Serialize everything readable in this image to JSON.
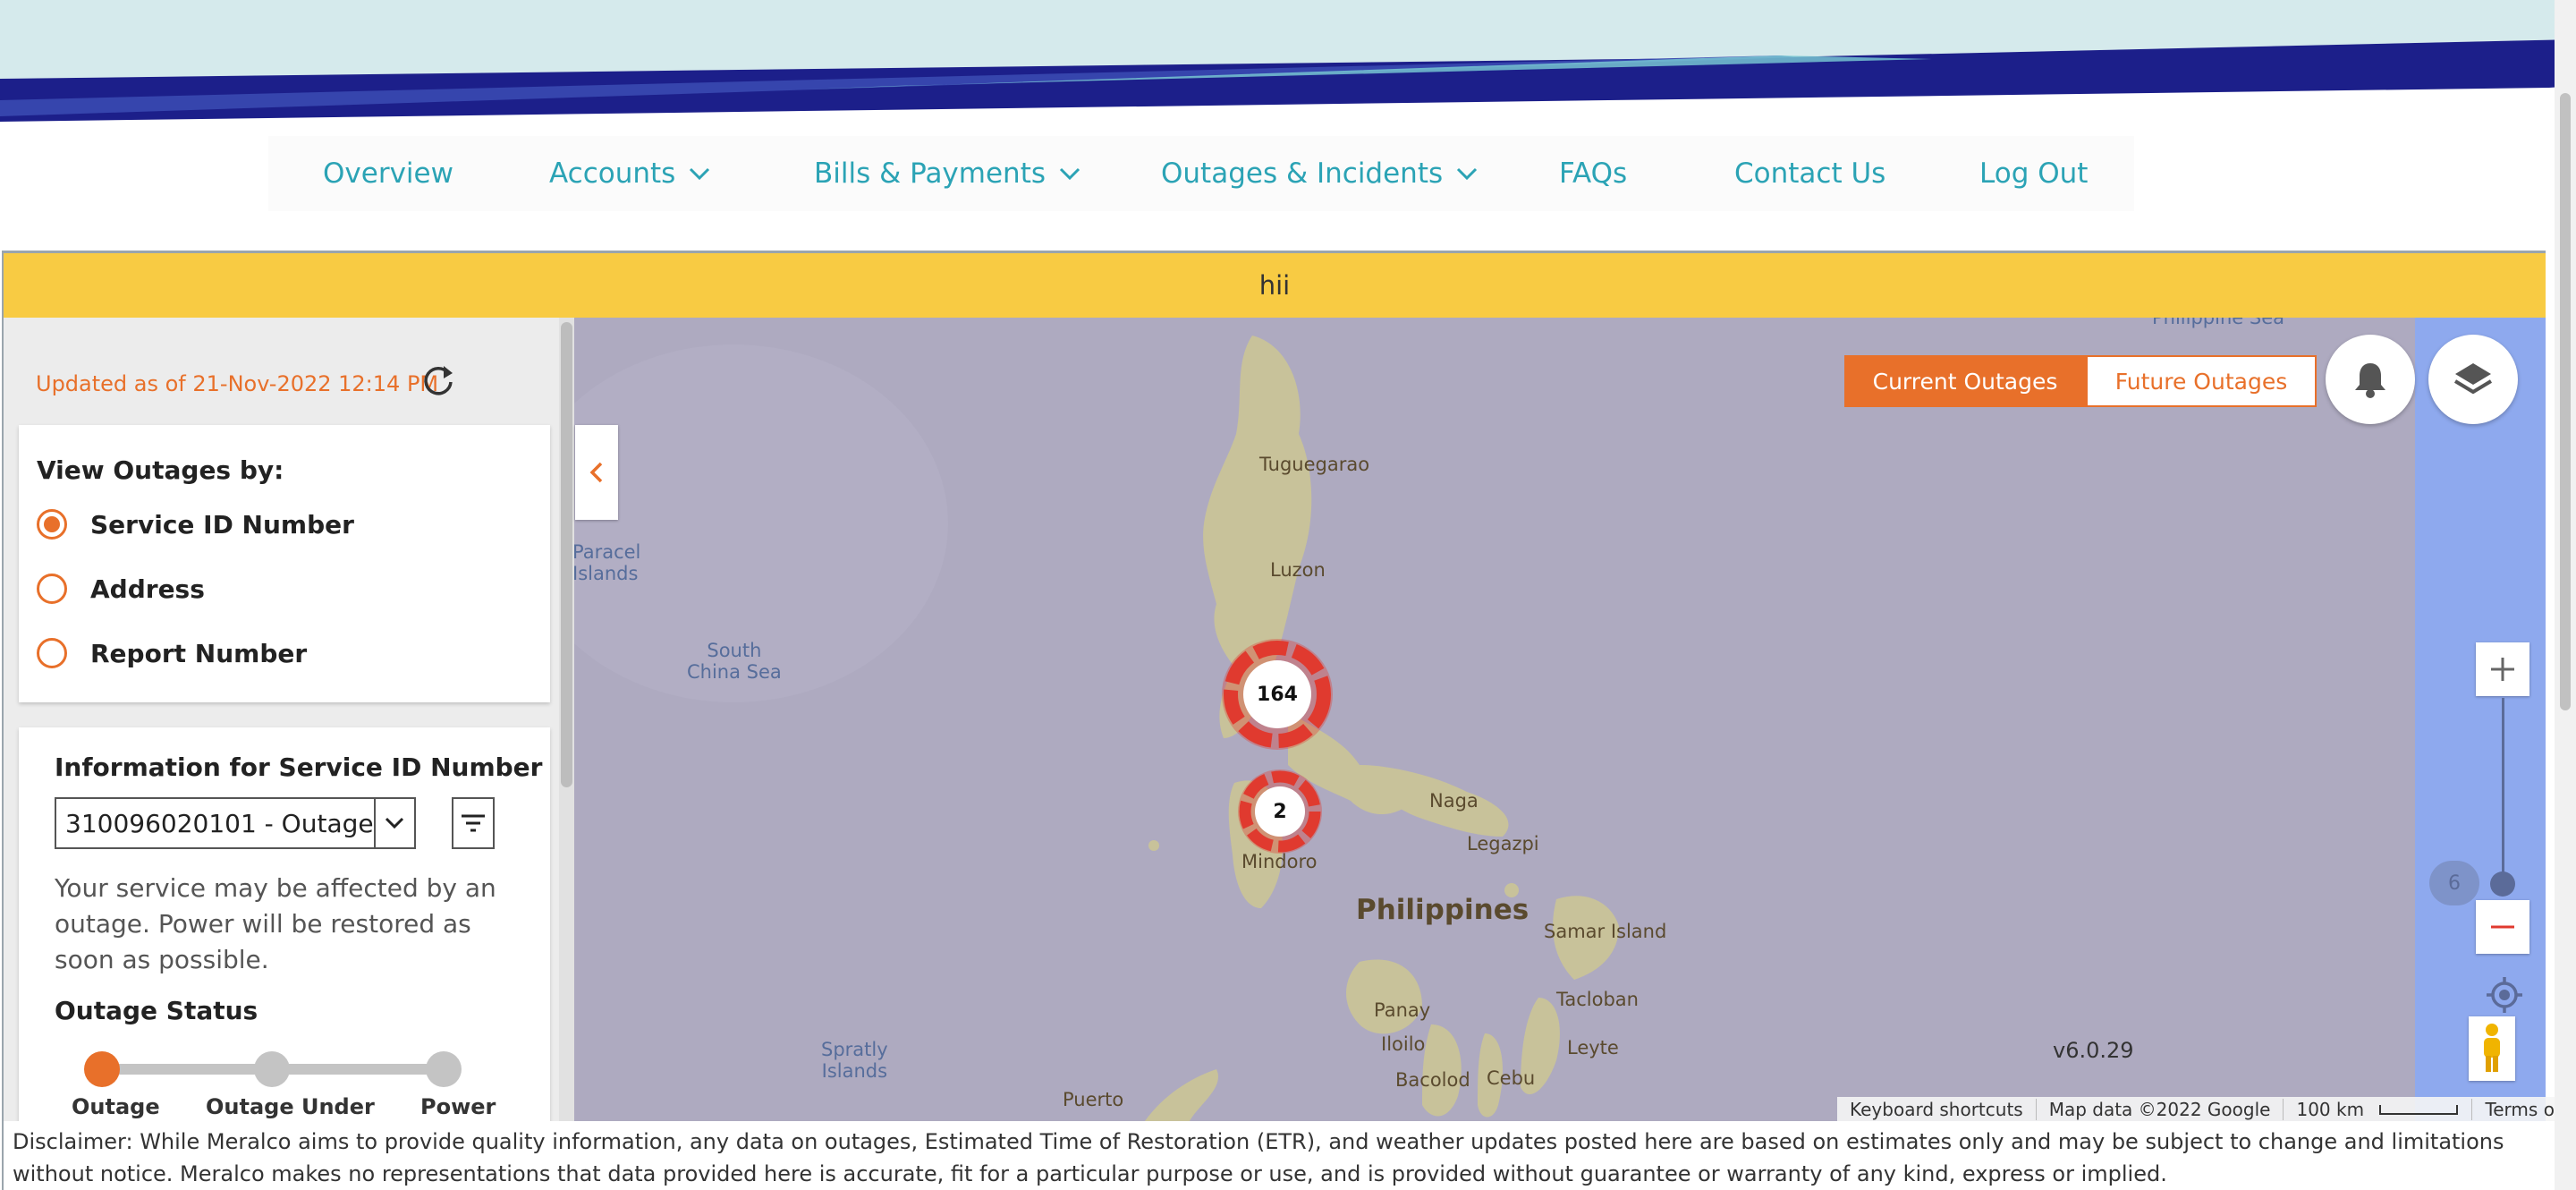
{
  "nav": {
    "items": [
      {
        "label": "Overview",
        "has_dropdown": false
      },
      {
        "label": "Accounts",
        "has_dropdown": true
      },
      {
        "label": "Bills & Payments",
        "has_dropdown": true
      },
      {
        "label": "Outages & Incidents",
        "has_dropdown": true
      },
      {
        "label": "FAQs",
        "has_dropdown": false
      },
      {
        "label": "Contact Us",
        "has_dropdown": false
      },
      {
        "label": "Log Out",
        "has_dropdown": false
      }
    ]
  },
  "notice": "hii",
  "panel": {
    "updated": "Updated as of 21-Nov-2022 12:14 PM",
    "view_by_title": "View Outages by:",
    "options": [
      {
        "label": "Service ID Number",
        "selected": true
      },
      {
        "label": "Address",
        "selected": false
      },
      {
        "label": "Report Number",
        "selected": false
      }
    ],
    "info_title": "Information for Service ID Number",
    "selected_service": "310096020101 - Outage",
    "service_message": "Your service may be affected by an outage. Power will be restored as soon as possible.",
    "status_title": "Outage Status",
    "status_steps": [
      "Outage",
      "Outage Under",
      "Power"
    ],
    "active_step": 0
  },
  "map": {
    "toggle_current": "Current Outages",
    "toggle_future": "Future Outages",
    "active_toggle": "current",
    "clusters": [
      {
        "count": "164"
      },
      {
        "count": "2"
      }
    ],
    "labels": {
      "tuguegarao": "Tuguegarao",
      "luzon": "Luzon",
      "naga": "Naga",
      "legazpi": "Legazpi",
      "mindoro": "Mindoro",
      "philippines": "Philippines",
      "samar": "Samar Island",
      "panay": "Panay",
      "iloilo": "Iloilo",
      "tacloban": "Tacloban",
      "leyte": "Leyte",
      "bacolod": "Bacolod",
      "cebu": "Cebu",
      "puerto": "Puerto",
      "paracel": "Paracel\nIslands",
      "south_china_sea": "South\nChina Sea",
      "spratly": "Spratly\nIslands",
      "philippine_sea": "Philippine Sea"
    },
    "zoom_level": "6",
    "version": "v6.0.29",
    "attribution": {
      "shortcuts": "Keyboard shortcuts",
      "map_data": "Map data ©2022 Google",
      "scale": "100 km",
      "terms": "Terms of Use"
    }
  },
  "disclaimer": "Disclaimer: While Meralco aims to provide quality information, any data on outages, Estimated Time of Restoration (ETR), and weather updates posted here are based on estimates only and may be subject to change and limitations without notice. Meralco makes no representations that data provided here is accurate, fit for a particular purpose or use, and is provided without guarantee or warranty of any kind, express or implied.",
  "colors": {
    "accent": "#e8702a",
    "nav_text": "#2ba3b5",
    "notice_bg": "#f8cb43",
    "banner_navy": "#1c1f8a",
    "cluster_red": "#e03a2f"
  }
}
